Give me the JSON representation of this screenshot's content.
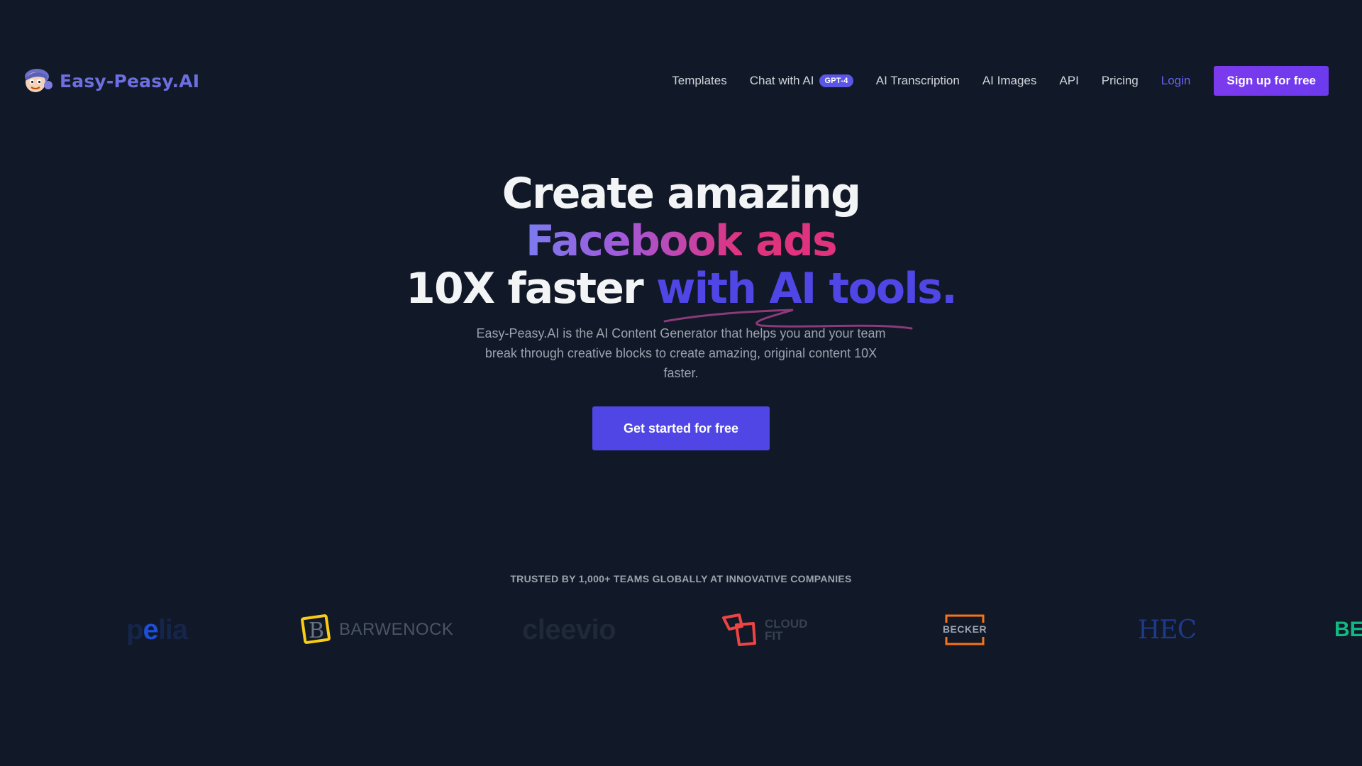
{
  "brand": {
    "name": "Easy-Peasy.AI",
    "logo_icon": "mascot-face-icon"
  },
  "nav": {
    "items": [
      {
        "label": "Templates"
      },
      {
        "label": "Chat with AI",
        "badge": "GPT-4"
      },
      {
        "label": "AI Transcription"
      },
      {
        "label": "AI Images"
      },
      {
        "label": "API"
      },
      {
        "label": "Pricing"
      }
    ],
    "login": "Login",
    "signup": "Sign up for free"
  },
  "hero": {
    "line1": "Create amazing",
    "line2_a": "Facebook",
    "line2_b": "ads",
    "line3_a": "10X faster",
    "line3_b": "with AI tools.",
    "subtitle": "Easy-Peasy.AI is the AI Content Generator that helps you and your team break through creative blocks to create amazing, original content 10X faster.",
    "cta": "Get started for free"
  },
  "trusted": {
    "heading": "TRUSTED BY 1,000+ TEAMS GLOBALLY AT INNOVATIVE COMPANIES",
    "logos": [
      {
        "name": "pelia",
        "text_a": "p",
        "text_b": "e",
        "text_c": "lia"
      },
      {
        "name": "barwenock",
        "text": "BARWENOCK"
      },
      {
        "name": "cleevio",
        "text": "cleevio"
      },
      {
        "name": "cloudfit",
        "text_a": "CLOUD",
        "text_b": "FIT"
      },
      {
        "name": "becker",
        "text": "BECKER"
      },
      {
        "name": "hec",
        "text": "HEC"
      },
      {
        "name": "be",
        "text": "BE"
      }
    ]
  },
  "colors": {
    "background": "#111827",
    "accent": "#4f46e5",
    "signup": "#7c3aed",
    "login": "#6366f1",
    "ads": "#e0337e"
  }
}
